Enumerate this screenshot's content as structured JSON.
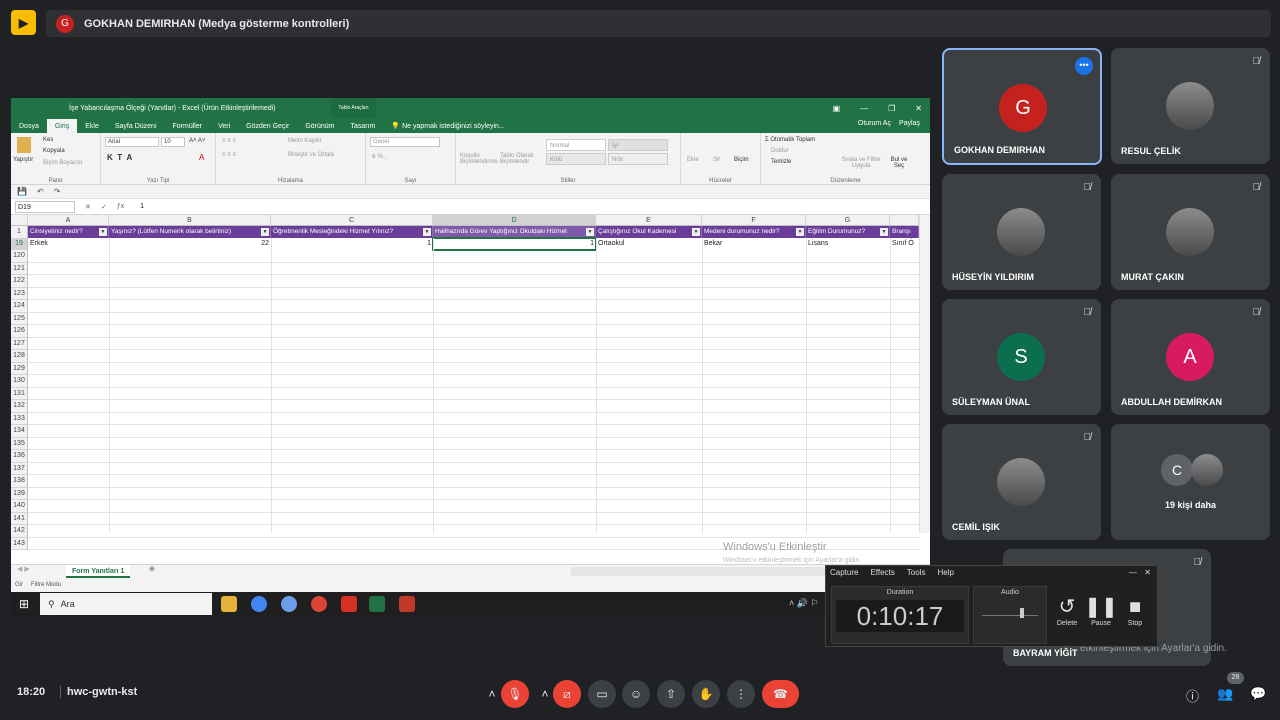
{
  "meet": {
    "presenter_initial": "G",
    "presenter_bar": "GOKHAN DEMIRHAN (Medya gösterme kontrolleri)",
    "time": "18:20",
    "meeting_code": "hwc-gwtn-kst",
    "badge_count": "28",
    "participants": [
      {
        "name": "GOKHAN DEMIRHAN",
        "initial": "G",
        "color": "#c5221f"
      },
      {
        "name": "RESUL ÇELİK",
        "initial": ""
      },
      {
        "name": "HÜSEYİN YILDIRIM",
        "initial": ""
      },
      {
        "name": "MURAT ÇAKIN",
        "initial": ""
      },
      {
        "name": "SÜLEYMAN ÜNAL",
        "initial": "S",
        "color": "#0b6e4f"
      },
      {
        "name": "ABDULLAH DEMİRKAN",
        "initial": "A",
        "color": "#d81b60"
      },
      {
        "name": "CEMİL IŞIK",
        "initial": ""
      },
      {
        "name": "19 kişi daha",
        "initial": "C"
      },
      {
        "name": "BAYRAM YİĞİT",
        "initial": ""
      }
    ],
    "watermark_overlay": "etkinleştirmek için Ayarlar'a gidin."
  },
  "excel": {
    "title": "İşe Yabancılaşma Ölçeği (Yanıtlar) - Excel (Ürün Etkinleştirilemedi)",
    "tools_tab": "Tablo Araçları",
    "tabs": [
      "Dosya",
      "Giriş",
      "Ekle",
      "Sayfa Düzeni",
      "Formüller",
      "Veri",
      "Gözden Geçir",
      "Görünüm",
      "Tasarım"
    ],
    "tell_me": "Ne yapmak istediğinizi söyleyin...",
    "sign_in": "Oturum Aç",
    "share": "Paylaş",
    "ribbon": {
      "paste": "Yapıştır",
      "cut": "Kes",
      "copy": "Kopyala",
      "format_painter": "Biçim Boyacısı",
      "clipboard": "Pano",
      "font_name": "Arial",
      "font_size": "10",
      "font_group": "Yazı Tipi",
      "wrap": "Metni Kaydır",
      "merge": "Birleştir ve Ortala",
      "alignment": "Hizalama",
      "number_format": "Genel",
      "number": "Sayı",
      "cond_format": "Koşullu Biçimlendirme",
      "format_table": "Tablo Olarak Biçimlendir",
      "style_normal": "Normal",
      "style_good": "İyi",
      "style_bad": "Kötü",
      "style_neutral": "Nötr",
      "styles": "Stiller",
      "insert": "Ekle",
      "delete": "Sil",
      "format": "Biçim",
      "cells": "Hücreler",
      "autosum": "Otomatik Toplam",
      "fill": "Doldur",
      "clear": "Temizle",
      "sort": "Sırala ve Filtre Uygula",
      "find": "Bul ve Seç",
      "editing": "Düzenleme"
    },
    "name_box": "D19",
    "formula_value": "1",
    "columns": [
      "A",
      "B",
      "C",
      "D",
      "E",
      "F",
      "G"
    ],
    "header_row": "1",
    "headers": [
      "Cinsiyetiniz nedir?",
      "Yaşınız? (Lütfen Numerik olarak belirtiniz)",
      "Öğretmenlik Mesleğindeki Hizmet Yılınız?",
      "Halihazırda Görev Yaptığınız Okuldaki Hizmet",
      "Çalıştığınız Okul Kademesi",
      "Medeni durumunuz nedir?",
      "Eğitim Durumunuz?",
      "Branşı"
    ],
    "data_row_num": "19",
    "data_row": [
      "Erkek",
      "22",
      "1",
      "1",
      "Ortaokul",
      "Bekar",
      "Lisans",
      "Sınıf Ö"
    ],
    "row_numbers": [
      "120",
      "121",
      "122",
      "123",
      "124",
      "125",
      "126",
      "127",
      "128",
      "129",
      "130",
      "131",
      "132",
      "133",
      "134",
      "135",
      "136",
      "137",
      "138",
      "139",
      "140",
      "141",
      "142",
      "143"
    ],
    "sheet_tab": "Form Yanıtları 1",
    "status_left": "Gir",
    "status_mode": "Filtre Modu",
    "activation": "Windows'u Etkinleştir",
    "activation_sub": "Windows'u etkinleştirmek için Ayarlar'a gidin."
  },
  "taskbar": {
    "search_placeholder": "Ara"
  },
  "recorder": {
    "menu": [
      "Capture",
      "Effects",
      "Tools",
      "Help"
    ],
    "duration_label": "Duration",
    "duration": "0:10:17",
    "audio_label": "Audio",
    "delete": "Delete",
    "pause": "Pause",
    "stop": "Stop"
  }
}
